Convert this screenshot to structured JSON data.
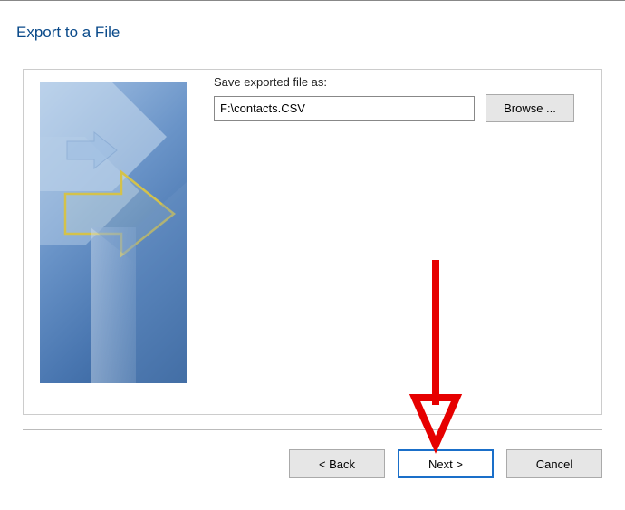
{
  "dialog": {
    "title": "Export to a File"
  },
  "form": {
    "save_label": "Save exported file as:",
    "file_path": "F:\\contacts.CSV",
    "browse_label": "Browse ..."
  },
  "buttons": {
    "back": "< Back",
    "next": "Next >",
    "cancel": "Cancel"
  },
  "icons": {
    "wizard_arrow": "arrow-export"
  }
}
